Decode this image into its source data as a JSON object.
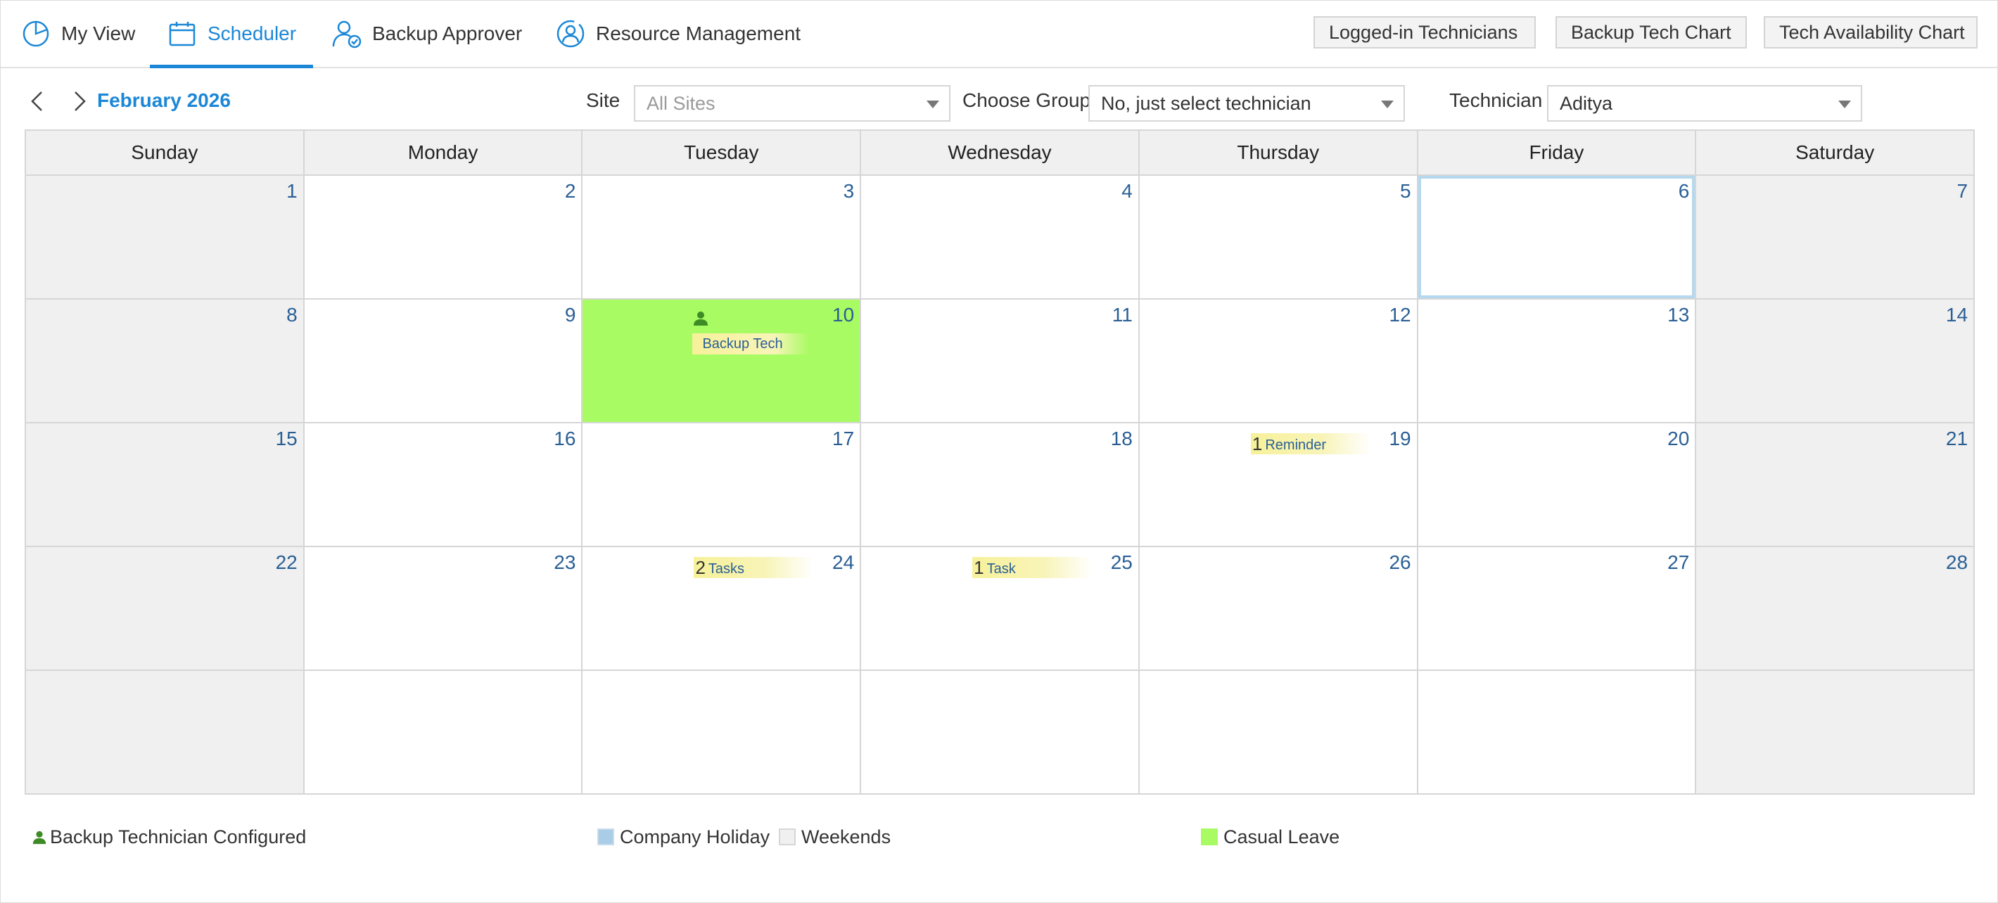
{
  "nav": {
    "tabs": [
      {
        "label": "My View",
        "icon": "pie-chart-icon",
        "active": false
      },
      {
        "label": "Scheduler",
        "icon": "calendar-icon",
        "active": true
      },
      {
        "label": "Backup Approver",
        "icon": "user-check-icon",
        "active": false
      },
      {
        "label": "Resource Management",
        "icon": "user-circle-icon",
        "active": false
      }
    ],
    "buttons": {
      "logged_in": "Logged-in Technicians",
      "backup_chart": "Backup Tech Chart",
      "availability_chart": "Tech Availability Chart"
    }
  },
  "toolbar": {
    "month_label": "February 2026",
    "site_label": "Site",
    "site_value": "All Sites",
    "group_label": "Choose Group",
    "group_value": "No, just select technician",
    "technician_label": "Technician",
    "technician_value": "Aditya"
  },
  "calendar": {
    "days_of_week": [
      "Sunday",
      "Monday",
      "Tuesday",
      "Wednesday",
      "Thursday",
      "Friday",
      "Saturday"
    ],
    "weeks": [
      [
        "1",
        "2",
        "3",
        "4",
        "5",
        "6",
        "7"
      ],
      [
        "8",
        "9",
        "10",
        "11",
        "12",
        "13",
        "14"
      ],
      [
        "15",
        "16",
        "17",
        "18",
        "19",
        "20",
        "21"
      ],
      [
        "22",
        "23",
        "24",
        "25",
        "26",
        "27",
        "28"
      ],
      [
        "",
        "",
        "",
        "",
        "",
        "",
        ""
      ]
    ],
    "today": "6",
    "casual_leave_day": "10",
    "backup_tech_label": "Backup Tech",
    "events": {
      "reminder_19": {
        "count": "1",
        "label": "Reminder"
      },
      "tasks_24": {
        "count": "2",
        "label": "Tasks"
      },
      "task_25": {
        "count": "1",
        "label": "Task"
      }
    }
  },
  "legend": {
    "backup": "Backup Technician Configured",
    "holiday": "Company Holiday",
    "weekends": "Weekends",
    "leave": "Casual Leave"
  },
  "colors": {
    "accent": "#1b87d6",
    "casual_leave": "#a9fb64",
    "company_holiday": "#a9cde6",
    "weekend": "#f0f0f0",
    "event_highlight": "#f7f19a",
    "backup_icon": "#3d8b25"
  }
}
